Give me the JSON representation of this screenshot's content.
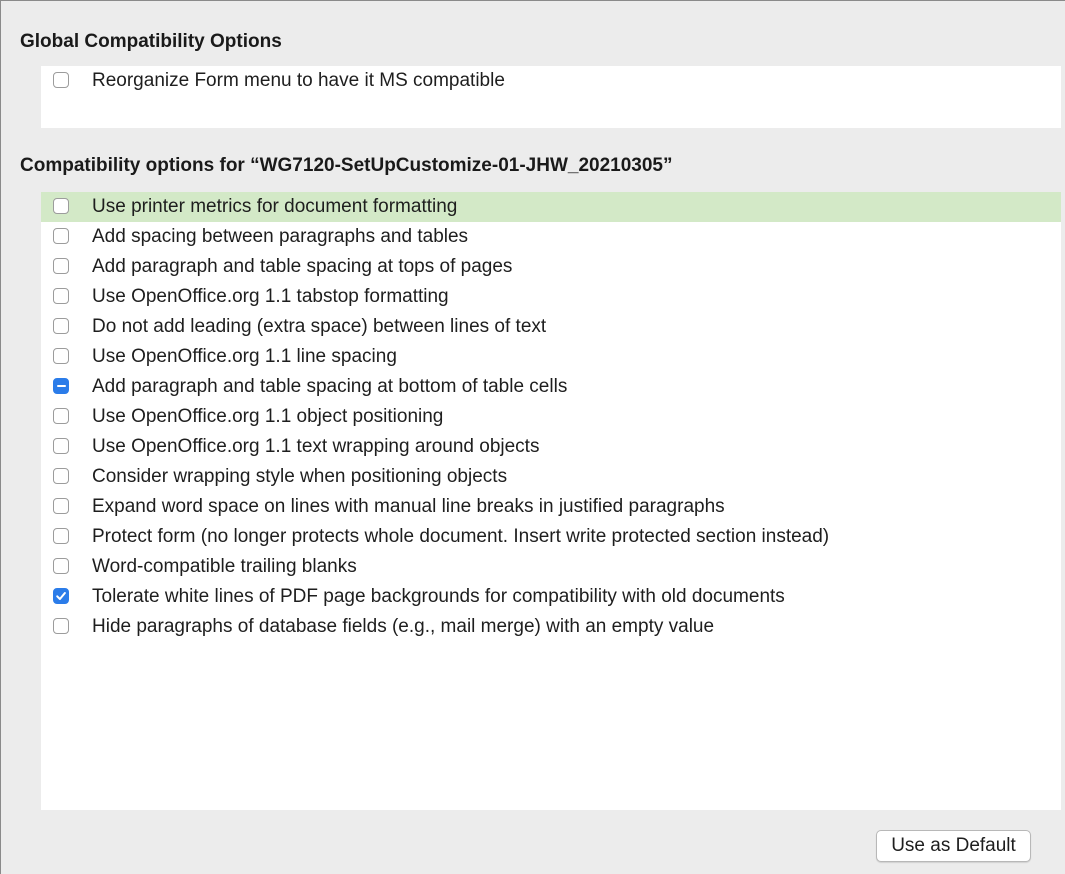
{
  "global_section": {
    "title": "Global Compatibility Options",
    "options": [
      {
        "label": "Reorganize Form menu to have it MS compatible",
        "state": "unchecked"
      }
    ]
  },
  "document_section": {
    "title": "Compatibility options for “WG7120-SetUpCustomize-01-JHW_20210305”",
    "options": [
      {
        "label": "Use printer metrics for document formatting",
        "state": "unchecked",
        "highlighted": true
      },
      {
        "label": "Add spacing between paragraphs and tables",
        "state": "unchecked"
      },
      {
        "label": "Add paragraph and table spacing at tops of pages",
        "state": "unchecked"
      },
      {
        "label": "Use OpenOffice.org 1.1 tabstop formatting",
        "state": "unchecked"
      },
      {
        "label": "Do not add leading (extra space) between lines of text",
        "state": "unchecked"
      },
      {
        "label": "Use OpenOffice.org 1.1 line spacing",
        "state": "unchecked"
      },
      {
        "label": "Add paragraph and table spacing at bottom of table cells",
        "state": "mixed"
      },
      {
        "label": "Use OpenOffice.org 1.1 object positioning",
        "state": "unchecked"
      },
      {
        "label": "Use OpenOffice.org 1.1 text wrapping around objects",
        "state": "unchecked"
      },
      {
        "label": "Consider wrapping style when positioning objects",
        "state": "unchecked"
      },
      {
        "label": "Expand word space on lines with manual line breaks in justified paragraphs",
        "state": "unchecked"
      },
      {
        "label": "Protect form (no longer protects whole document. Insert write protected section instead)",
        "state": "unchecked"
      },
      {
        "label": "Word-compatible trailing blanks",
        "state": "unchecked"
      },
      {
        "label": "Tolerate white lines of PDF page backgrounds for compatibility with old documents",
        "state": "checked"
      },
      {
        "label": "Hide paragraphs of database fields (e.g., mail merge) with an empty value",
        "state": "unchecked"
      }
    ]
  },
  "buttons": {
    "use_as_default": "Use as Default"
  },
  "colors": {
    "dialog_bg": "#ececec",
    "list_bg": "#ffffff",
    "highlight_row": "#d3e9c7",
    "accent_checkbox": "#2b7ce9"
  }
}
